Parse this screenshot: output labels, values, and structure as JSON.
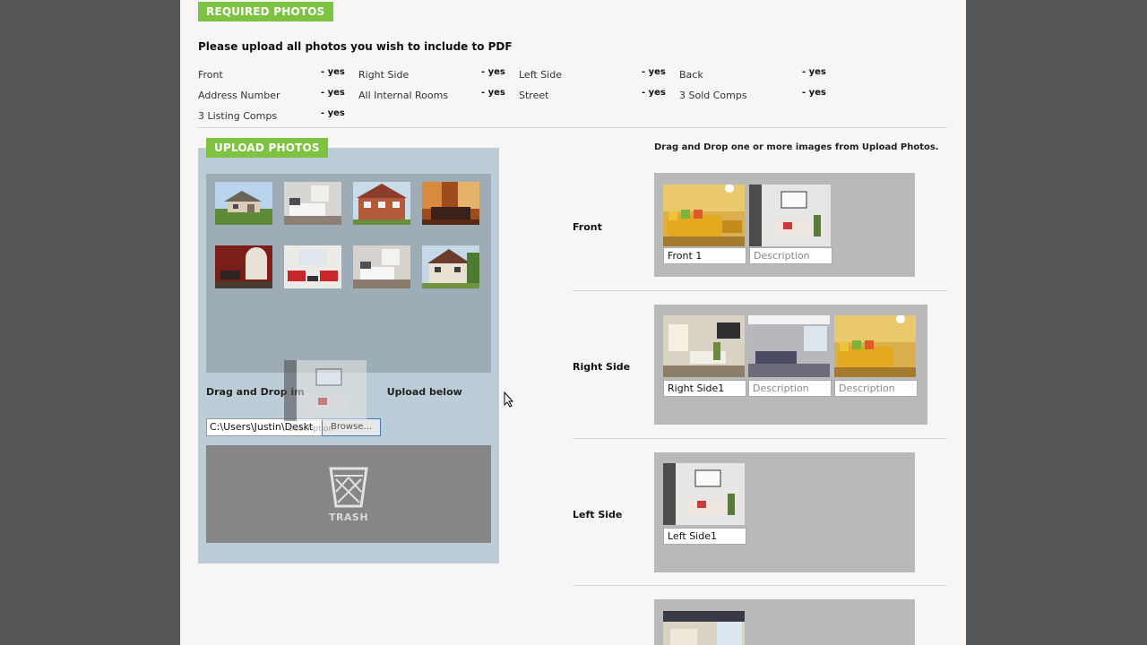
{
  "required": {
    "tag": "REQUIRED PHOTOS",
    "heading": "Please upload all photos you wish to include to PDF",
    "items": [
      {
        "label": "Front",
        "status": "- yes"
      },
      {
        "label": "Right Side",
        "status": "- yes"
      },
      {
        "label": "Left Side",
        "status": "- yes"
      },
      {
        "label": "Back",
        "status": "- yes"
      },
      {
        "label": "Address Number",
        "status": "- yes"
      },
      {
        "label": "All Internal Rooms",
        "status": "- yes"
      },
      {
        "label": "Street",
        "status": "- yes"
      },
      {
        "label": "3 Sold Comps",
        "status": "- yes"
      },
      {
        "label": "3 Listing Comps",
        "status": "- yes"
      }
    ]
  },
  "upload": {
    "tag": "UPLOAD PHOTOS",
    "drag_text_left": "Drag and Drop im",
    "drag_text_right": "Upload below",
    "file_value": "C:\\Users\\Justin\\Deskt",
    "browse_label": "Browse...",
    "trash_label": "TRASH",
    "ghost_caption": "Description"
  },
  "right": {
    "instruction": "Drag and Drop one or more images from Upload Photos.",
    "sections": [
      {
        "label": "Front",
        "captions": [
          "Front 1",
          "Description"
        ]
      },
      {
        "label": "Right Side",
        "captions": [
          "Right Side1",
          "Description",
          "Description"
        ]
      },
      {
        "label": "Left Side",
        "captions": [
          "Left Side1"
        ]
      },
      {
        "label": "",
        "captions": []
      }
    ]
  },
  "colors": {
    "accent_green": "#7ec242",
    "upload_bg": "#bccdd7",
    "drop_bg": "#b9b9b9"
  }
}
